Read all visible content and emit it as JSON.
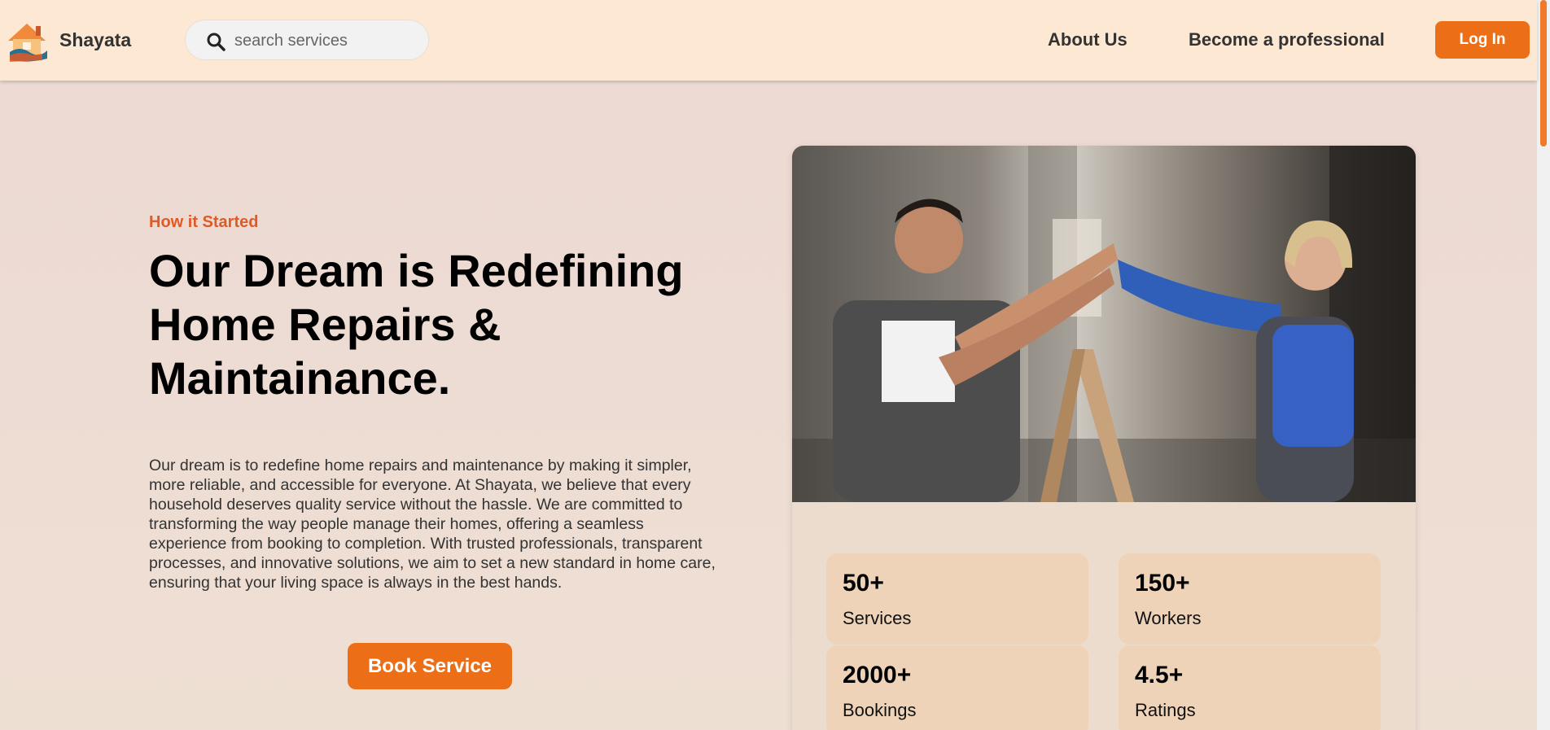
{
  "header": {
    "brand": "Shayata",
    "search": {
      "placeholder": "search services"
    },
    "nav": {
      "about": "About Us",
      "become_pro": "Become a professional"
    },
    "login_label": "Log In"
  },
  "hero": {
    "eyebrow": "How it Started",
    "headline": "Our Dream is Redefining Home Repairs & Maintainance.",
    "description": "Our dream is to redefine home repairs and maintenance by making it simpler, more reliable, and accessible for everyone. At Shayata, we believe that every household deserves quality service without the hassle. We are committed to transforming the way people manage their homes, offering a seamless experience from booking to completion. With trusted professionals, transparent processes, and innovative solutions, we aim to set a new standard in home care, ensuring that your living space is always in the best hands.",
    "cta_label": "Book Service"
  },
  "stats": [
    {
      "value": "50+",
      "label": "Services"
    },
    {
      "value": "150+",
      "label": "Workers"
    },
    {
      "value": "2000+",
      "label": "Bookings"
    },
    {
      "value": "4.5+",
      "label": "Ratings"
    }
  ],
  "colors": {
    "accent": "#ec6f17",
    "eyebrow": "#e05a26",
    "header_bg": "#fde9d3",
    "stat_bg": "#eed3b8"
  },
  "icons": [
    "house-hand-logo",
    "search-icon"
  ]
}
